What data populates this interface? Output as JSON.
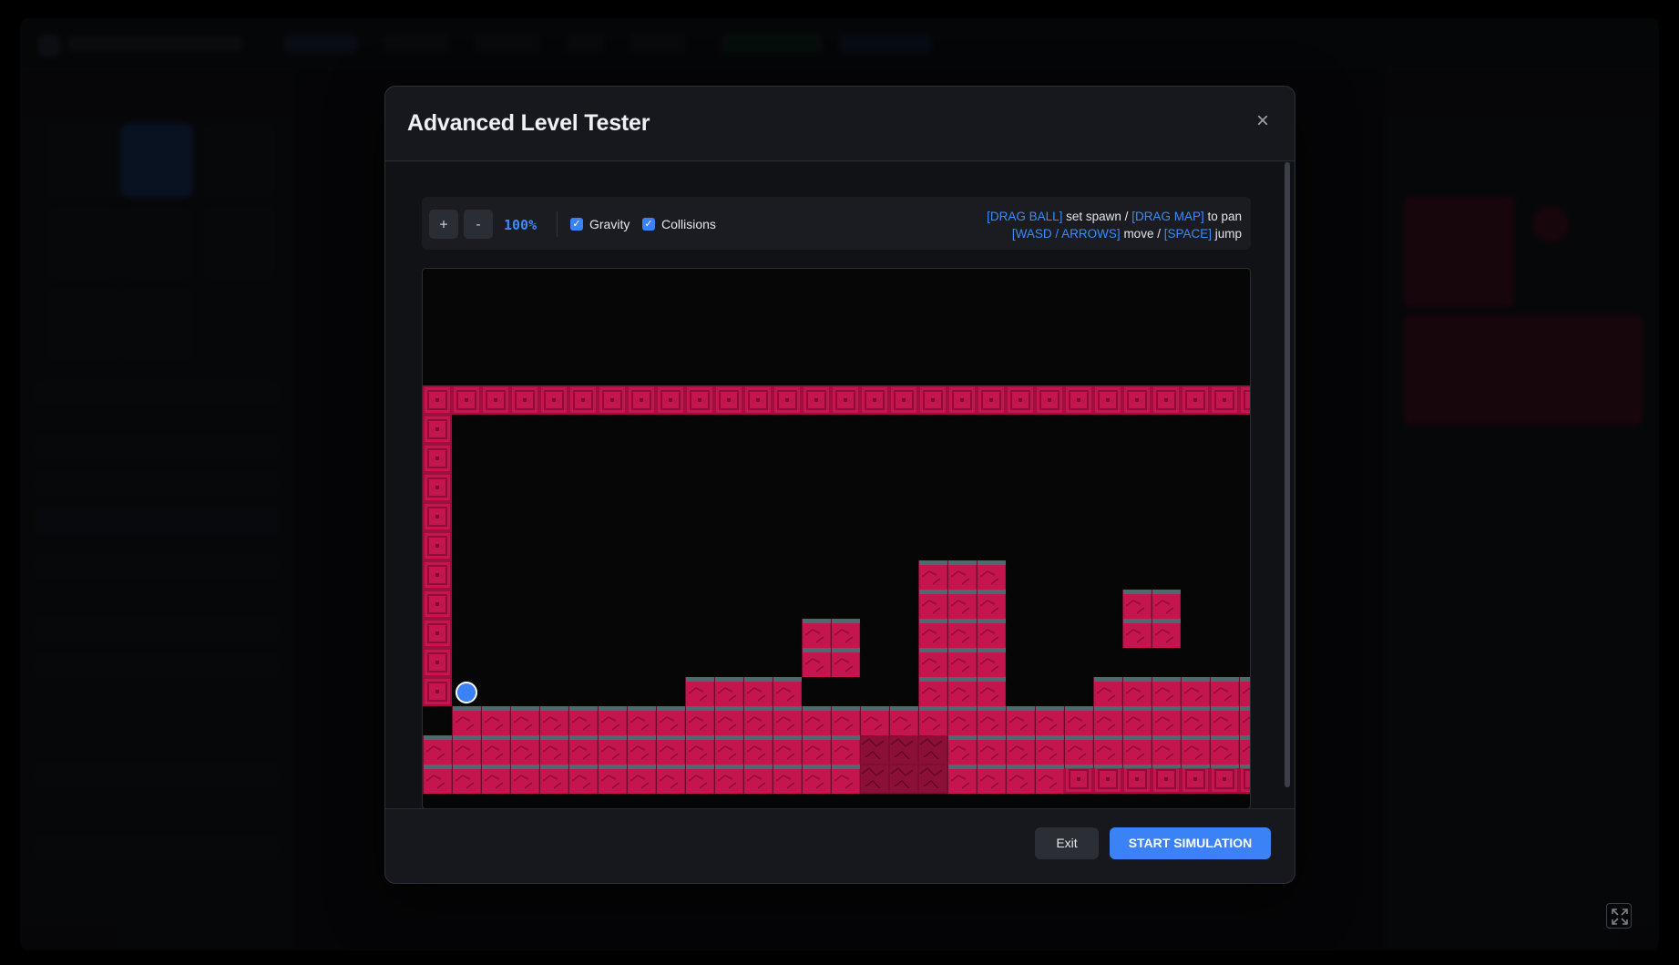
{
  "modal": {
    "title": "Advanced Level Tester",
    "close_label": "×"
  },
  "toolbar": {
    "zoom_in_label": "+",
    "zoom_out_label": "-",
    "zoom_level": "100%",
    "gravity_label": "Gravity",
    "gravity_checked": true,
    "collisions_label": "Collisions",
    "collisions_checked": true,
    "check_glyph": "✓"
  },
  "hints": {
    "line1": {
      "key1": "[DRAG BALL]",
      "text1": " set spawn / ",
      "key2": "[DRAG MAP]",
      "text2": " to pan"
    },
    "line2": {
      "key1": "[WASD / ARROWS]",
      "text1": " move / ",
      "key2": "[SPACE]",
      "text2": " jump"
    }
  },
  "footer": {
    "exit_label": "Exit",
    "start_label": "START SIMULATION"
  },
  "colors": {
    "accent": "#3b82f6",
    "brick": "#c4154f",
    "grass_top": "#4f6a6c"
  },
  "icons": {
    "close": "close-icon",
    "fullscreen": "fullscreen-icon",
    "player": "player-ball-icon"
  }
}
